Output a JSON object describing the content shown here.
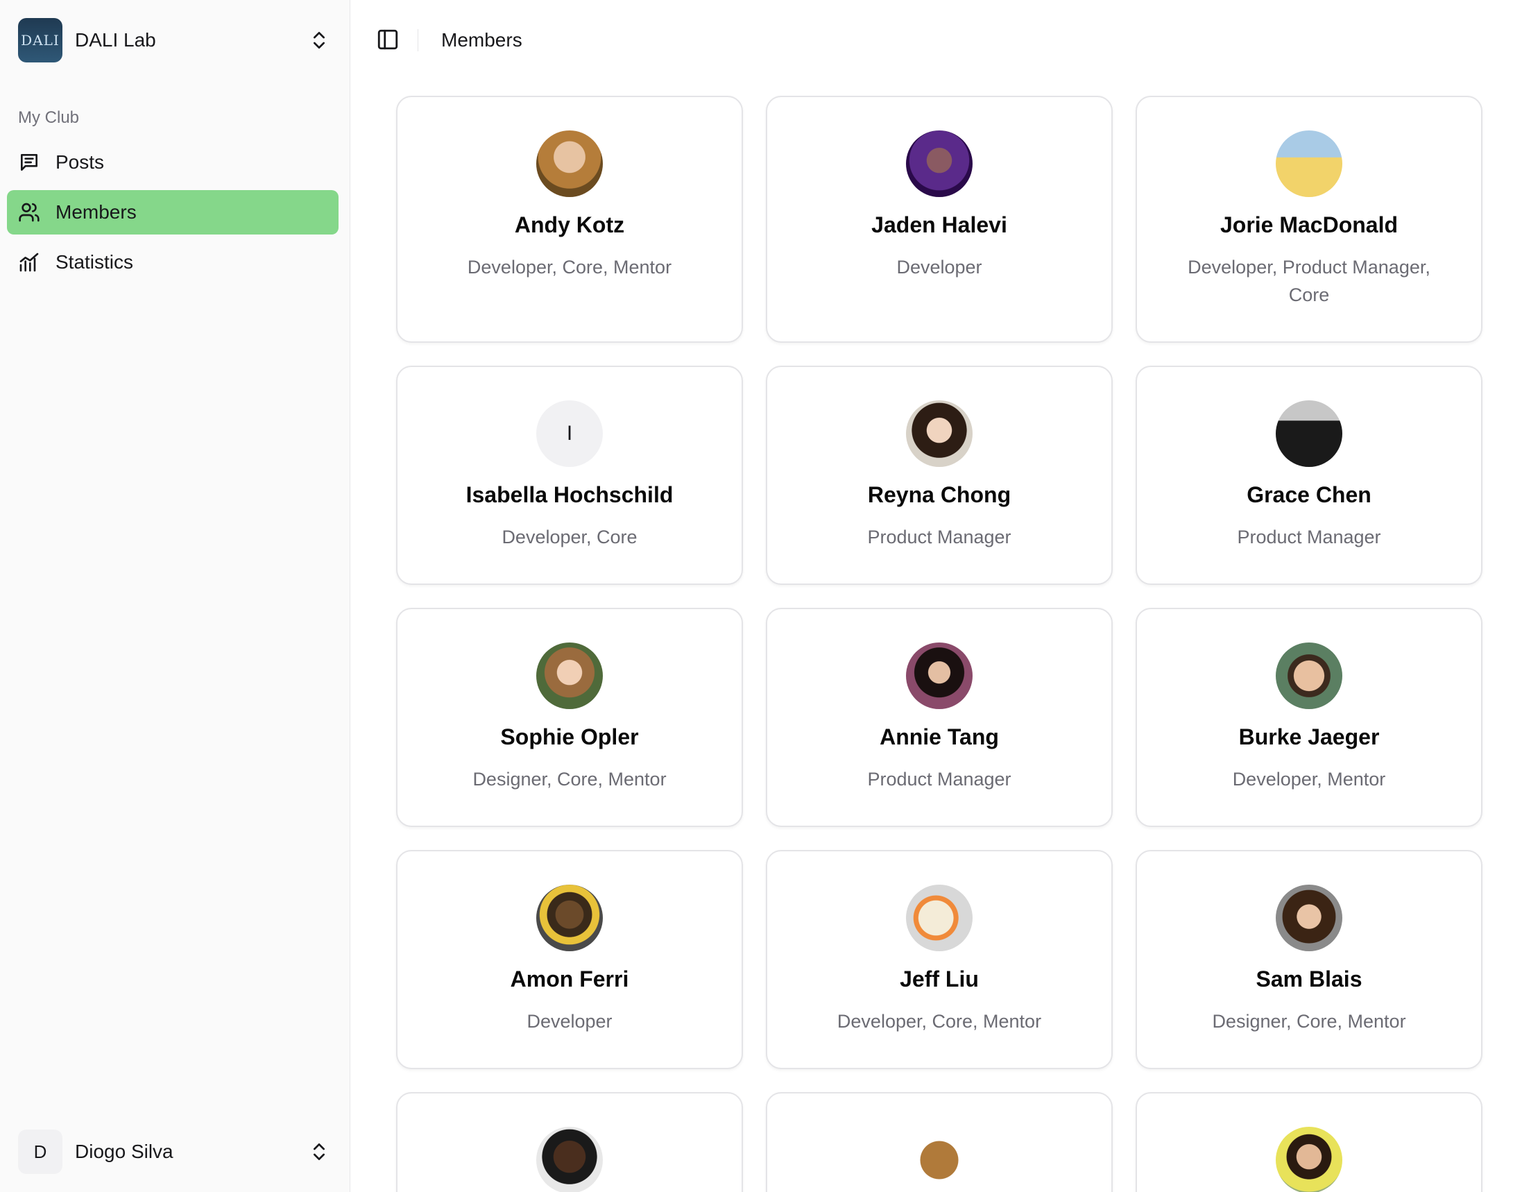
{
  "sidebar": {
    "club": {
      "logo_text": "DALI",
      "name": "DALI Lab"
    },
    "section_label": "My Club",
    "items": [
      {
        "label": "Posts",
        "icon": "message-square-icon",
        "active": false
      },
      {
        "label": "Members",
        "icon": "users-icon",
        "active": true
      },
      {
        "label": "Statistics",
        "icon": "chart-icon",
        "active": false
      }
    ],
    "user": {
      "initial": "D",
      "name": "Diogo Silva"
    }
  },
  "header": {
    "breadcrumb": "Members"
  },
  "colors": {
    "active_nav": "#85d78a"
  },
  "members": [
    {
      "name": "Andy Kotz",
      "roles": "Developer, Core, Mentor"
    },
    {
      "name": "Jaden Halevi",
      "roles": "Developer"
    },
    {
      "name": "Jorie MacDonald",
      "roles": "Developer, Product Manager, Core"
    },
    {
      "name": "Isabella Hochschild",
      "roles": "Developer, Core",
      "initial": "I"
    },
    {
      "name": "Reyna Chong",
      "roles": "Product Manager"
    },
    {
      "name": "Grace Chen",
      "roles": "Product Manager"
    },
    {
      "name": "Sophie Opler",
      "roles": "Designer, Core, Mentor"
    },
    {
      "name": "Annie Tang",
      "roles": "Product Manager"
    },
    {
      "name": "Burke Jaeger",
      "roles": "Developer, Mentor"
    },
    {
      "name": "Amon Ferri",
      "roles": "Developer"
    },
    {
      "name": "Jeff Liu",
      "roles": "Developer, Core, Mentor"
    },
    {
      "name": "Sam Blais",
      "roles": "Designer, Core, Mentor"
    }
  ]
}
